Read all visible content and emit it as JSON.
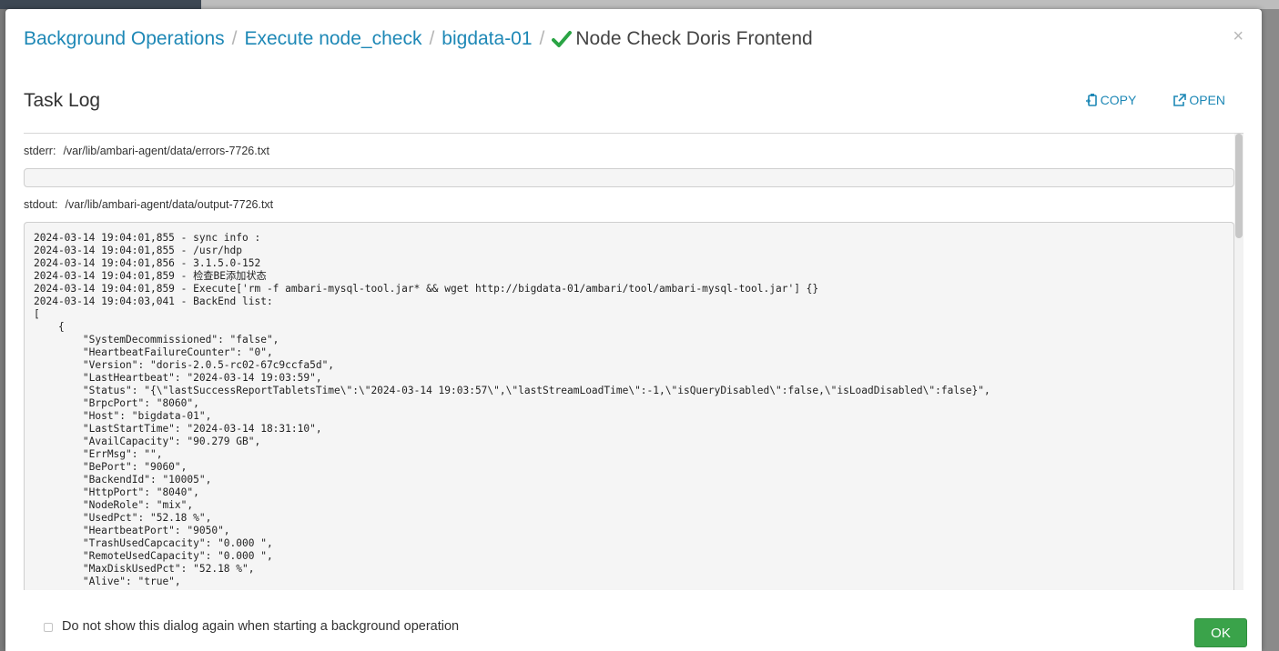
{
  "breadcrumb": {
    "items": [
      "Background Operations",
      "Execute node_check",
      "bigdata-01"
    ],
    "current": "Node Check Doris Frontend",
    "separator": "/"
  },
  "close_label": "×",
  "task_log": {
    "title": "Task Log",
    "copy_label": "COPY",
    "open_label": "OPEN"
  },
  "stderr": {
    "label": "stderr:",
    "path": "/var/lib/ambari-agent/data/errors-7726.txt",
    "content": ""
  },
  "stdout": {
    "label": "stdout:",
    "path": "/var/lib/ambari-agent/data/output-7726.txt",
    "content": "2024-03-14 19:04:01,855 - sync info :\n2024-03-14 19:04:01,855 - /usr/hdp\n2024-03-14 19:04:01,856 - 3.1.5.0-152\n2024-03-14 19:04:01,859 - 检查BE添加状态\n2024-03-14 19:04:01,859 - Execute['rm -f ambari-mysql-tool.jar* && wget http://bigdata-01/ambari/tool/ambari-mysql-tool.jar'] {}\n2024-03-14 19:04:03,041 - BackEnd list:\n[\n    {\n        \"SystemDecommissioned\": \"false\",\n        \"HeartbeatFailureCounter\": \"0\",\n        \"Version\": \"doris-2.0.5-rc02-67c9ccfa5d\",\n        \"LastHeartbeat\": \"2024-03-14 19:03:59\",\n        \"Status\": \"{\\\"lastSuccessReportTabletsTime\\\":\\\"2024-03-14 19:03:57\\\",\\\"lastStreamLoadTime\\\":-1,\\\"isQueryDisabled\\\":false,\\\"isLoadDisabled\\\":false}\",\n        \"BrpcPort\": \"8060\",\n        \"Host\": \"bigdata-01\",\n        \"LastStartTime\": \"2024-03-14 18:31:10\",\n        \"AvailCapacity\": \"90.279 GB\",\n        \"ErrMsg\": \"\",\n        \"BePort\": \"9060\",\n        \"BackendId\": \"10005\",\n        \"HttpPort\": \"8040\",\n        \"NodeRole\": \"mix\",\n        \"UsedPct\": \"52.18 %\",\n        \"HeartbeatPort\": \"9050\",\n        \"TrashUsedCapcacity\": \"0.000 \",\n        \"RemoteUsedCapacity\": \"0.000 \",\n        \"MaxDiskUsedPct\": \"52.18 %\",\n        \"Alive\": \"true\","
  },
  "footer": {
    "checkbox_label": "Do not show this dialog again when starting a background operation",
    "ok_label": "OK"
  },
  "colors": {
    "link": "#1e88b6",
    "success": "#2aa444",
    "ok_button": "#3aa34a"
  }
}
